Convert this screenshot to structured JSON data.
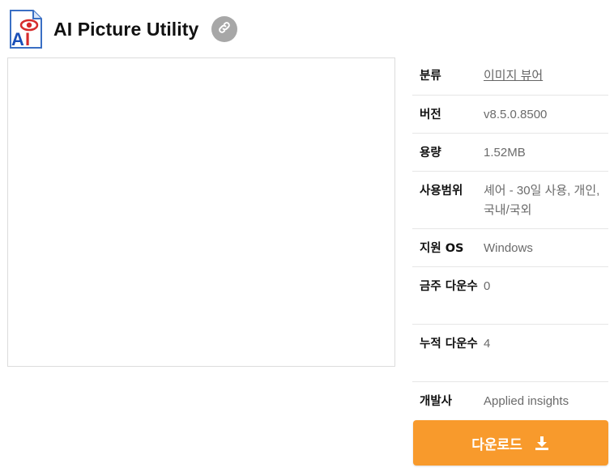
{
  "app": {
    "title": "AI Picture Utility",
    "logo_icon": "ai-picture-utility-logo"
  },
  "header": {
    "link_icon": "link-icon"
  },
  "info": {
    "category_label": "분류",
    "category_value": "이미지 뷰어",
    "version_label": "버전",
    "version_value": "v8.5.0.8500",
    "size_label": "용량",
    "size_value": "1.52MB",
    "license_label": "사용범위",
    "license_value": "셰어 - 30일 사용, 개인, 국내/국외",
    "os_label": "지원 OS",
    "os_value": "Windows",
    "weekly_downloads_label": "금주 다운수",
    "weekly_downloads_value": "0",
    "total_downloads_label": "누적 다운수",
    "total_downloads_value": "4",
    "developer_label": "개발사",
    "developer_value": "Applied insights"
  },
  "download": {
    "label": "다운로드",
    "icon": "download-icon",
    "color": "#f89a2c"
  },
  "colors": {
    "link_button_bg": "#a7a7a7",
    "text_muted": "#6b6b6b"
  }
}
